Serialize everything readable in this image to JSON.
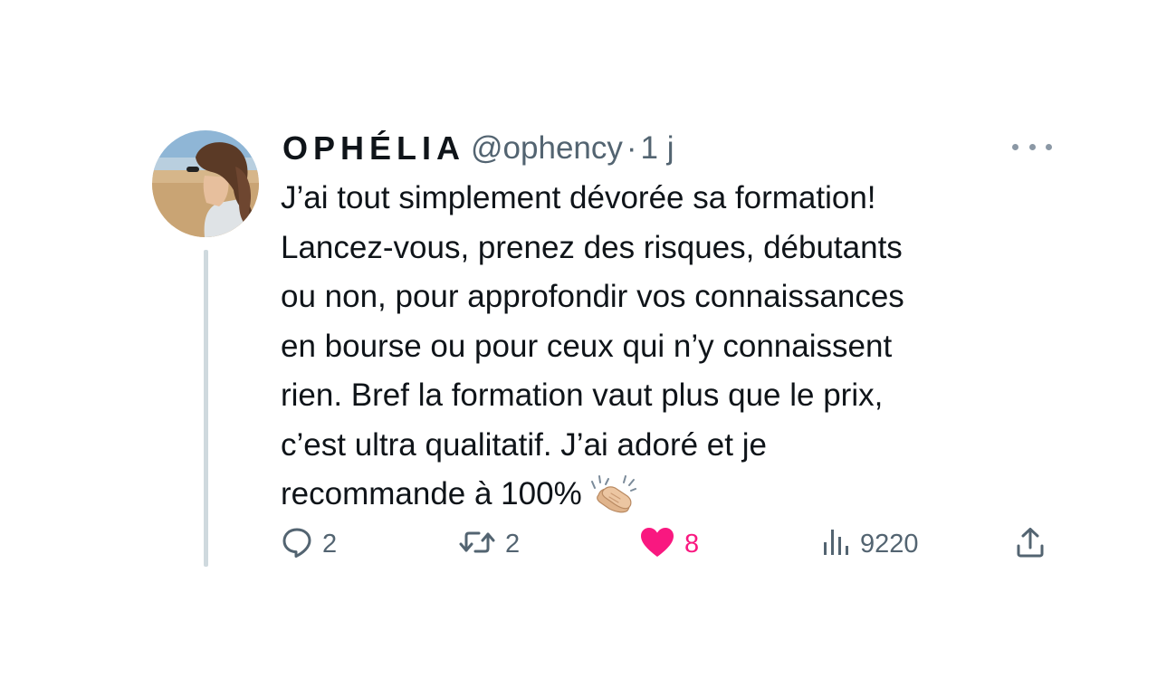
{
  "author": {
    "display_name": "OPHÉLIA",
    "handle": "@ophency",
    "separator": "·",
    "time": "1 j"
  },
  "tweet": {
    "lines": [
      "J’ai tout simplement dévorée sa formation!",
      "Lancez-vous, prenez des risques, débutants",
      "ou non, pour approfondir vos connaissances",
      "en bourse ou pour ceux qui n’y connaissent",
      "rien. Bref la formation vaut plus que le prix,",
      "c’est ultra qualitatif. J’ai adoré et je",
      "recommande à 100%"
    ],
    "emoji": "clapping-hands-emoji"
  },
  "actions": {
    "replies": "2",
    "retweets": "2",
    "likes": "8",
    "views": "9220"
  },
  "colors": {
    "text": "#0f1419",
    "secondary": "#536471",
    "like": "#f91880",
    "thread_line": "#cfd9de"
  },
  "icons": {
    "more": "more-icon",
    "reply": "reply-icon",
    "retweet": "retweet-icon",
    "like": "heart-icon",
    "views": "views-icon",
    "share": "share-icon"
  }
}
